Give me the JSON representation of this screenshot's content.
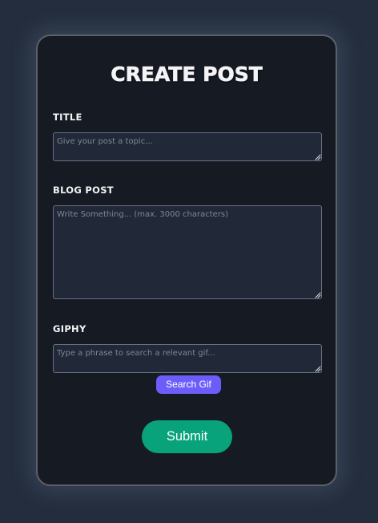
{
  "form": {
    "title": "CREATE POST",
    "fields": [
      {
        "label": "TITLE",
        "value": "",
        "placeholder": "Give your post a topic..."
      },
      {
        "label": "BLOG POST",
        "value": "",
        "placeholder": "Write Something... (max. 3000 characters)"
      },
      {
        "label": "GIPHY",
        "value": "",
        "placeholder": "Type a phrase to search a relevant gif..."
      }
    ],
    "search_button_label": "Search Gif",
    "submit_button_label": "Submit"
  },
  "colors": {
    "background": "#232d3d",
    "card": "#151a23",
    "card_border": "#5d6067",
    "field_background": "#212938",
    "field_border": "#697082",
    "search_button": "#6c5dfb",
    "submit_button": "#08a37a",
    "text": "#f4f4f6",
    "placeholder": "#7f8694"
  },
  "icons": {
    "resize_handle": "resize-grip-icon"
  }
}
